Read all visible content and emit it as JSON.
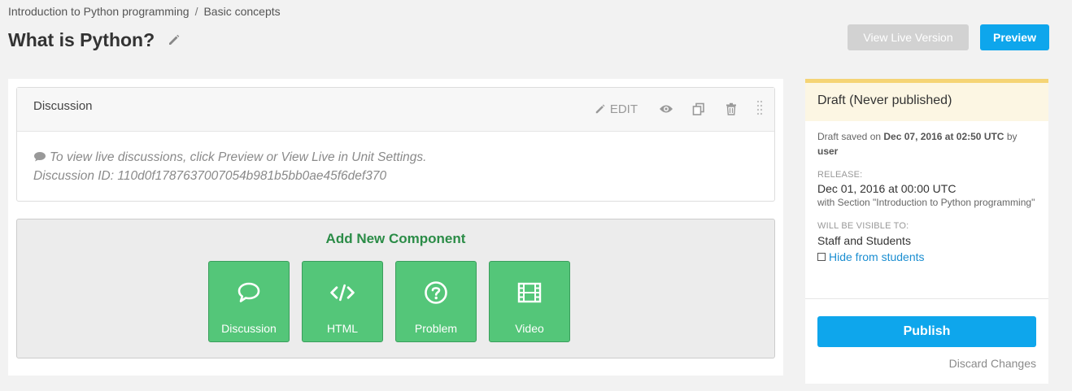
{
  "breadcrumb": {
    "course": "Introduction to Python programming",
    "separator": "/",
    "section": "Basic concepts"
  },
  "page": {
    "title": "What is Python?"
  },
  "header_buttons": {
    "view_live": "View Live Version",
    "preview": "Preview"
  },
  "xblock": {
    "title": "Discussion",
    "edit_label": "EDIT",
    "body_line1": "To view live discussions, click Preview or View Live in Unit Settings.",
    "body_line2": "Discussion ID: 110d0f1787637007054b981b5bb0ae45f6def370"
  },
  "add_component": {
    "title": "Add New Component",
    "buttons": [
      {
        "label": "Discussion",
        "icon": "chat-bubble-icon"
      },
      {
        "label": "HTML",
        "icon": "code-icon"
      },
      {
        "label": "Problem",
        "icon": "question-circle-icon"
      },
      {
        "label": "Video",
        "icon": "film-icon"
      }
    ]
  },
  "sidebar": {
    "status_title": "Draft (Never published)",
    "draft_saved_prefix": "Draft saved on",
    "draft_saved_date": "Dec 07, 2016 at 02:50 UTC",
    "draft_saved_by": "by",
    "draft_saved_user": "user",
    "release_label": "RELEASE:",
    "release_date": "Dec 01, 2016 at 00:00 UTC",
    "release_note": "with Section \"Introduction to Python programming\"",
    "visible_label": "WILL BE VISIBLE TO:",
    "visible_value": "Staff and Students",
    "hide_link": "Hide from students",
    "publish": "Publish",
    "discard": "Discard Changes"
  },
  "colors": {
    "accent": "#0ea6ec",
    "green": "#54c679",
    "green_title": "#2b8c47",
    "draft_bar": "#f5d475"
  }
}
